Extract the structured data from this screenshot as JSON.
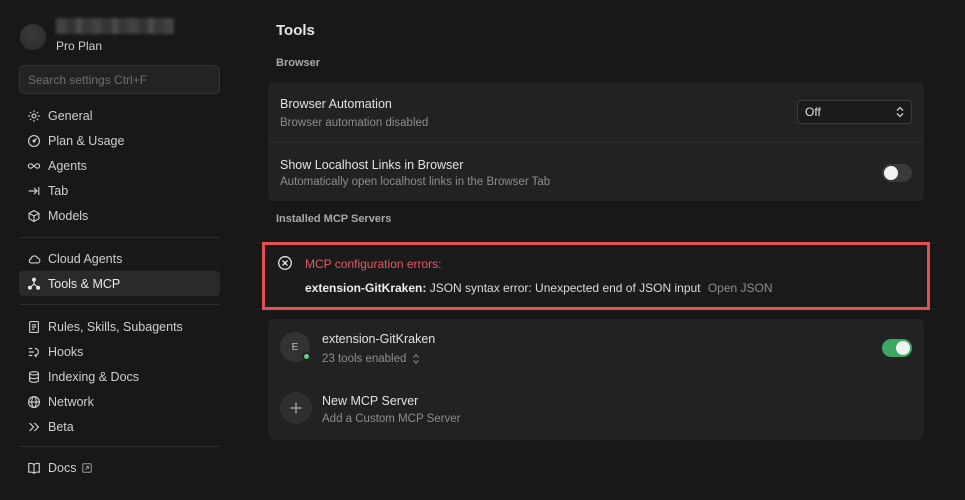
{
  "profile": {
    "plan": "Pro Plan"
  },
  "search": {
    "placeholder": "Search settings Ctrl+F"
  },
  "sidebar": {
    "group1": [
      {
        "label": "General",
        "icon": "gear-icon"
      },
      {
        "label": "Plan & Usage",
        "icon": "gauge-icon"
      },
      {
        "label": "Agents",
        "icon": "infinity-icon"
      },
      {
        "label": "Tab",
        "icon": "tab-arrow-icon"
      },
      {
        "label": "Models",
        "icon": "cube-icon"
      }
    ],
    "group2": [
      {
        "label": "Cloud Agents",
        "icon": "cloud-icon"
      },
      {
        "label": "Tools & MCP",
        "icon": "nodes-icon",
        "active": true
      }
    ],
    "group3": [
      {
        "label": "Rules, Skills, Subagents",
        "icon": "document-icon"
      },
      {
        "label": "Hooks",
        "icon": "hooks-icon"
      },
      {
        "label": "Indexing & Docs",
        "icon": "database-icon"
      },
      {
        "label": "Network",
        "icon": "globe-icon"
      },
      {
        "label": "Beta",
        "icon": "double-chevron-icon"
      }
    ],
    "group4": [
      {
        "label": "Docs",
        "icon": "book-icon"
      }
    ]
  },
  "main": {
    "title": "Tools",
    "browser_section": "Browser",
    "browser_automation": {
      "title": "Browser Automation",
      "subtitle": "Browser automation disabled",
      "select_value": "Off"
    },
    "localhost_links": {
      "title": "Show Localhost Links in Browser",
      "subtitle": "Automatically open localhost links in the Browser Tab",
      "enabled": false
    },
    "mcp_section": "Installed MCP Servers",
    "error": {
      "title": "MCP configuration errors:",
      "server": "extension-GitKraken:",
      "message": "JSON syntax error: Unexpected end of JSON input",
      "link": "Open JSON"
    },
    "server": {
      "avatar_letter": "E",
      "name": "extension-GitKraken",
      "tools": "23 tools enabled",
      "enabled": true
    },
    "new_server": {
      "title": "New MCP Server",
      "subtitle": "Add a Custom MCP Server"
    }
  },
  "colors": {
    "background": "#181818",
    "card": "#222222",
    "error_border": "#e05252",
    "error_text": "#e5586a",
    "toggle_on": "#3aa860",
    "status_dot": "#5fcf7a"
  }
}
